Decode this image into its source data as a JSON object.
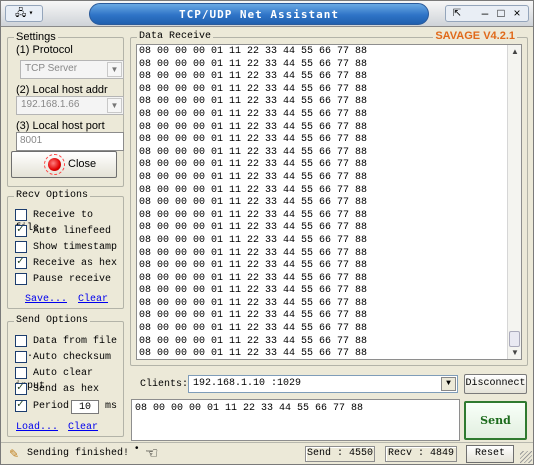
{
  "window": {
    "title": "TCP/UDP Net Assistant",
    "version": "SAVAGE V4.2.1",
    "controls": {
      "minimize": "–",
      "maximize": "□",
      "close": "×"
    },
    "app_icon": "network-icon"
  },
  "settings": {
    "group_label": "Settings",
    "protocol_label": "(1) Protocol",
    "protocol_value": "TCP Server",
    "host_addr_label": "(2) Local host addr",
    "host_addr_value": "192.168.1.66",
    "host_port_label": "(3) Local host port",
    "host_port_value": "8001",
    "close_button_label": "Close"
  },
  "recv_options": {
    "group_label": "Recv Options",
    "items": [
      {
        "label": "Receive to file...",
        "checked": false
      },
      {
        "label": "Auto linefeed",
        "checked": true
      },
      {
        "label": "Show timestamp",
        "checked": false
      },
      {
        "label": "Receive as hex",
        "checked": true
      },
      {
        "label": "Pause receive",
        "checked": false
      }
    ],
    "save_link": "Save...",
    "clear_link": "Clear"
  },
  "send_options": {
    "group_label": "Send Options",
    "items": [
      {
        "label": "Data from file ...",
        "checked": false
      },
      {
        "label": "Auto checksum",
        "checked": false
      },
      {
        "label": "Auto clear input",
        "checked": false
      },
      {
        "label": "Send as hex",
        "checked": true
      }
    ],
    "period_label": "Period",
    "period_checked": true,
    "period_value": "10",
    "period_unit": "ms",
    "load_link": "Load...",
    "clear_link": "Clear"
  },
  "data_receive": {
    "title": "Data Receive",
    "lines": [
      "08 00 00 00 01 11 22 33 44 55 66 77 88",
      "08 00 00 00 01 11 22 33 44 55 66 77 88",
      "08 00 00 00 01 11 22 33 44 55 66 77 88",
      "08 00 00 00 01 11 22 33 44 55 66 77 88",
      "08 00 00 00 01 11 22 33 44 55 66 77 88",
      "08 00 00 00 01 11 22 33 44 55 66 77 88",
      "08 00 00 00 01 11 22 33 44 55 66 77 88",
      "08 00 00 00 01 11 22 33 44 55 66 77 88",
      "08 00 00 00 01 11 22 33 44 55 66 77 88",
      "08 00 00 00 01 11 22 33 44 55 66 77 88",
      "08 00 00 00 01 11 22 33 44 55 66 77 88",
      "08 00 00 00 01 11 22 33 44 55 66 77 88",
      "08 00 00 00 01 11 22 33 44 55 66 77 88",
      "08 00 00 00 01 11 22 33 44 55 66 77 88",
      "08 00 00 00 01 11 22 33 44 55 66 77 88",
      "08 00 00 00 01 11 22 33 44 55 66 77 88",
      "08 00 00 00 01 11 22 33 44 55 66 77 88",
      "08 00 00 00 01 11 22 33 44 55 66 77 88",
      "08 00 00 00 01 11 22 33 44 55 66 77 88",
      "08 00 00 00 01 11 22 33 44 55 66 77 88",
      "08 00 00 00 01 11 22 33 44 55 66 77 88",
      "08 00 00 00 01 11 22 33 44 55 66 77 88",
      "08 00 00 00 01 11 22 33 44 55 66 77 88",
      "08 00 00 00 01 11 22 33 44 55 66 77 88",
      "08 00 00 00 01 11 22 33 44 55 66 77 88"
    ]
  },
  "clients": {
    "label": "Clients:",
    "value": "192.168.1.10 :1029",
    "disconnect_label": "Disconnect"
  },
  "send": {
    "input_value": "08 00 00 00 01 11 22 33 44 55 66 77 88",
    "button_label": "Send"
  },
  "status": {
    "text": "Sending finished!",
    "send_count": "Send : 4550",
    "recv_count": "Recv : 4849",
    "reset_label": "Reset"
  }
}
